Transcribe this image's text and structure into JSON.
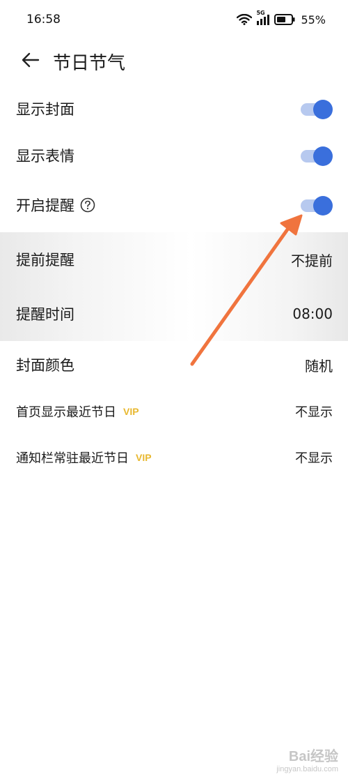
{
  "status_bar": {
    "time": "16:58",
    "network": "5G",
    "battery": "55%"
  },
  "header": {
    "title": "节日节气"
  },
  "settings": [
    {
      "label": "显示封面",
      "toggle": true
    },
    {
      "label": "显示表情",
      "toggle": true
    },
    {
      "label": "开启提醒",
      "toggle": true
    },
    {
      "label": "提前提醒",
      "value": "不提前"
    },
    {
      "label": "提醒时间",
      "value": "08:00"
    },
    {
      "label": "封面颜色",
      "value": "随机"
    },
    {
      "label": "首页显示最近节日",
      "badge": "VIP",
      "value": "不显示"
    },
    {
      "label": "通知栏常驻最近节日",
      "badge": "VIP",
      "value": "不显示"
    }
  ],
  "colors": {
    "toggle_on": "#3a6fdc",
    "vip": "#e8b830",
    "annotation_arrow": "#f0743e"
  },
  "watermark": {
    "text": "Bai经验",
    "sub": "jingyan.baidu.com"
  }
}
